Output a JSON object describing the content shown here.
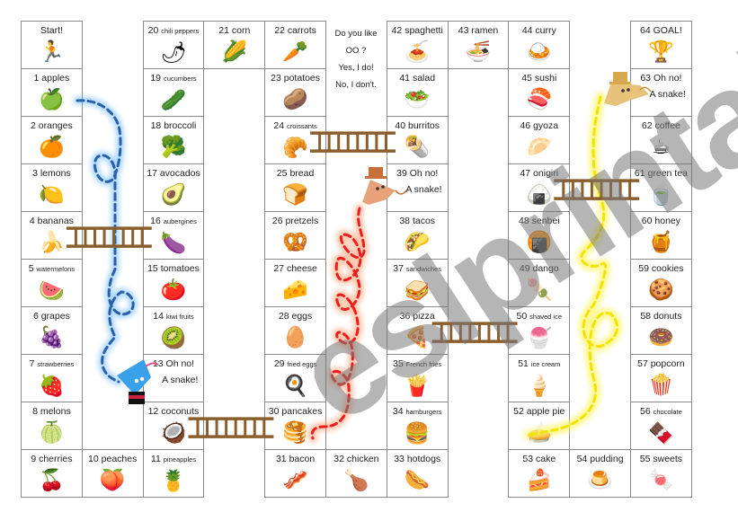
{
  "board": {
    "question": [
      "Do you like",
      "OO ?",
      "Yes, I do!",
      "No, I don't."
    ],
    "cells": [
      {
        "n": "",
        "label": "Start!",
        "small": false,
        "icon": "runner-icon",
        "glyph": "🏃",
        "col": 0,
        "row": 0
      },
      {
        "n": "1",
        "label": "apples",
        "small": false,
        "icon": "apple-icon",
        "glyph": "🍏",
        "col": 0,
        "row": 1
      },
      {
        "n": "2",
        "label": "oranges",
        "small": false,
        "icon": "orange-icon",
        "glyph": "🍊",
        "col": 0,
        "row": 2
      },
      {
        "n": "3",
        "label": "lemons",
        "small": false,
        "icon": "lemon-icon",
        "glyph": "🍋",
        "col": 0,
        "row": 3
      },
      {
        "n": "4",
        "label": "bananas",
        "small": false,
        "icon": "banana-icon",
        "glyph": "🍌",
        "col": 0,
        "row": 4
      },
      {
        "n": "5",
        "label": "watermelons",
        "small": true,
        "icon": "watermelon-icon",
        "glyph": "🍉",
        "col": 0,
        "row": 5
      },
      {
        "n": "6",
        "label": "grapes",
        "small": false,
        "icon": "grapes-icon",
        "glyph": "🍇",
        "col": 0,
        "row": 6
      },
      {
        "n": "7",
        "label": "strawberries",
        "small": true,
        "icon": "strawberry-icon",
        "glyph": "🍓",
        "col": 0,
        "row": 7
      },
      {
        "n": "8",
        "label": "melons",
        "small": false,
        "icon": "melon-icon",
        "glyph": "🍈",
        "col": 0,
        "row": 8
      },
      {
        "n": "9",
        "label": "cherries",
        "small": false,
        "icon": "cherries-icon",
        "glyph": "🍒",
        "col": 0,
        "row": 9
      },
      {
        "n": "10",
        "label": "peaches",
        "small": false,
        "icon": "peach-icon",
        "glyph": "🍑",
        "col": 1,
        "row": 9
      },
      {
        "n": "11",
        "label": "pineapples",
        "small": true,
        "icon": "pineapple-icon",
        "glyph": "🍍",
        "col": 2,
        "row": 9
      },
      {
        "n": "12",
        "label": "coconuts",
        "small": false,
        "icon": "coconut-icon",
        "glyph": "🥥",
        "col": 2,
        "row": 8
      },
      {
        "n": "13",
        "label": "Oh no!",
        "small": false,
        "icon": "",
        "glyph": "",
        "snake": "A snake!",
        "col": 2,
        "row": 7
      },
      {
        "n": "14",
        "label": "kiwi fruits",
        "small": true,
        "icon": "kiwi-icon",
        "glyph": "🥝",
        "col": 2,
        "row": 6
      },
      {
        "n": "15",
        "label": "tomatoes",
        "small": false,
        "icon": "tomato-icon",
        "glyph": "🍅",
        "col": 2,
        "row": 5
      },
      {
        "n": "16",
        "label": "aubergines",
        "small": true,
        "icon": "eggplant-icon",
        "glyph": "🍆",
        "col": 2,
        "row": 4
      },
      {
        "n": "17",
        "label": "avocados",
        "small": false,
        "icon": "avocado-icon",
        "glyph": "🥑",
        "col": 2,
        "row": 3
      },
      {
        "n": "18",
        "label": "broccoli",
        "small": false,
        "icon": "broccoli-icon",
        "glyph": "🥦",
        "col": 2,
        "row": 2
      },
      {
        "n": "19",
        "label": "cucumbers",
        "small": true,
        "icon": "cucumber-icon",
        "glyph": "🥒",
        "col": 2,
        "row": 1
      },
      {
        "n": "20",
        "label": "chili peppers",
        "small": true,
        "icon": "chili-pepper-icon",
        "glyph": "🌶",
        "col": 2,
        "row": 0
      },
      {
        "n": "21",
        "label": "corn",
        "small": false,
        "icon": "corn-icon",
        "glyph": "🌽",
        "col": 3,
        "row": 0
      },
      {
        "n": "22",
        "label": "carrots",
        "small": false,
        "icon": "carrot-icon",
        "glyph": "🥕",
        "col": 4,
        "row": 0
      },
      {
        "n": "23",
        "label": "potatoes",
        "small": false,
        "icon": "potato-icon",
        "glyph": "🥔",
        "col": 4,
        "row": 1
      },
      {
        "n": "24",
        "label": "croissants",
        "small": true,
        "icon": "croissant-icon",
        "glyph": "🥐",
        "col": 4,
        "row": 2
      },
      {
        "n": "25",
        "label": "bread",
        "small": false,
        "icon": "bread-icon",
        "glyph": "🍞",
        "col": 4,
        "row": 3
      },
      {
        "n": "26",
        "label": "pretzels",
        "small": false,
        "icon": "pretzel-icon",
        "glyph": "🥨",
        "col": 4,
        "row": 4
      },
      {
        "n": "27",
        "label": "cheese",
        "small": false,
        "icon": "cheese-icon",
        "glyph": "🧀",
        "col": 4,
        "row": 5
      },
      {
        "n": "28",
        "label": "eggs",
        "small": false,
        "icon": "egg-icon",
        "glyph": "🥚",
        "col": 4,
        "row": 6
      },
      {
        "n": "29",
        "label": "fried eggs",
        "small": true,
        "icon": "fried-egg-icon",
        "glyph": "🍳",
        "col": 4,
        "row": 7
      },
      {
        "n": "30",
        "label": "pancakes",
        "small": false,
        "icon": "pancakes-icon",
        "glyph": "🥞",
        "col": 4,
        "row": 8
      },
      {
        "n": "31",
        "label": "bacon",
        "small": false,
        "icon": "bacon-icon",
        "glyph": "🥓",
        "col": 4,
        "row": 9
      },
      {
        "n": "32",
        "label": "chicken",
        "small": false,
        "icon": "chicken-leg-icon",
        "glyph": "🍗",
        "col": 5,
        "row": 9
      },
      {
        "n": "33",
        "label": "hotdogs",
        "small": false,
        "icon": "hotdog-icon",
        "glyph": "🌭",
        "col": 6,
        "row": 9
      },
      {
        "n": "34",
        "label": "hamburgers",
        "small": true,
        "icon": "hamburger-icon",
        "glyph": "🍔",
        "col": 6,
        "row": 8
      },
      {
        "n": "35",
        "label": "French fries",
        "small": true,
        "icon": "french-fries-icon",
        "glyph": "🍟",
        "col": 6,
        "row": 7
      },
      {
        "n": "36",
        "label": "pizza",
        "small": false,
        "icon": "pizza-icon",
        "glyph": "🍕",
        "col": 6,
        "row": 6
      },
      {
        "n": "37",
        "label": "sandwiches",
        "small": true,
        "icon": "sandwich-icon",
        "glyph": "🥪",
        "col": 6,
        "row": 5
      },
      {
        "n": "38",
        "label": "tacos",
        "small": false,
        "icon": "taco-icon",
        "glyph": "🌮",
        "col": 6,
        "row": 4
      },
      {
        "n": "39",
        "label": "Oh no!",
        "small": false,
        "icon": "",
        "glyph": "",
        "snake": "A snake!",
        "col": 6,
        "row": 3
      },
      {
        "n": "40",
        "label": "burritos",
        "small": false,
        "icon": "burrito-icon",
        "glyph": "🌯",
        "col": 6,
        "row": 2
      },
      {
        "n": "41",
        "label": "salad",
        "small": false,
        "icon": "salad-icon",
        "glyph": "🥗",
        "col": 6,
        "row": 1
      },
      {
        "n": "42",
        "label": "spaghetti",
        "small": false,
        "icon": "spaghetti-icon",
        "glyph": "🍝",
        "col": 6,
        "row": 0
      },
      {
        "n": "43",
        "label": "ramen",
        "small": false,
        "icon": "ramen-icon",
        "glyph": "🍜",
        "col": 7,
        "row": 0
      },
      {
        "n": "44",
        "label": "curry",
        "small": false,
        "icon": "curry-icon",
        "glyph": "🍛",
        "col": 8,
        "row": 0
      },
      {
        "n": "45",
        "label": "sushi",
        "small": false,
        "icon": "sushi-icon",
        "glyph": "🍣",
        "col": 8,
        "row": 1
      },
      {
        "n": "46",
        "label": "gyoza",
        "small": false,
        "icon": "dumpling-icon",
        "glyph": "🥟",
        "col": 8,
        "row": 2
      },
      {
        "n": "47",
        "label": "onigiri",
        "small": false,
        "icon": "rice-ball-icon",
        "glyph": "🍙",
        "col": 8,
        "row": 3
      },
      {
        "n": "48",
        "label": "senbei",
        "small": false,
        "icon": "rice-cracker-icon",
        "glyph": "🍘",
        "col": 8,
        "row": 4
      },
      {
        "n": "49",
        "label": "dango",
        "small": false,
        "icon": "dango-icon",
        "glyph": "🍡",
        "col": 8,
        "row": 5
      },
      {
        "n": "50",
        "label": "shaved ice",
        "small": true,
        "icon": "shaved-ice-icon",
        "glyph": "🍧",
        "col": 8,
        "row": 6
      },
      {
        "n": "51",
        "label": "ice cream",
        "small": true,
        "icon": "ice-cream-icon",
        "glyph": "🍦",
        "col": 8,
        "row": 7
      },
      {
        "n": "52",
        "label": "apple pie",
        "small": false,
        "icon": "pie-icon",
        "glyph": "🥧",
        "col": 8,
        "row": 8
      },
      {
        "n": "53",
        "label": "cake",
        "small": false,
        "icon": "cake-icon",
        "glyph": "🍰",
        "col": 8,
        "row": 9
      },
      {
        "n": "54",
        "label": "pudding",
        "small": false,
        "icon": "pudding-icon",
        "glyph": "🍮",
        "col": 9,
        "row": 9
      },
      {
        "n": "55",
        "label": "sweets",
        "small": false,
        "icon": "candy-icon",
        "glyph": "🍬",
        "col": 10,
        "row": 9
      },
      {
        "n": "56",
        "label": "chocolate",
        "small": true,
        "icon": "chocolate-icon",
        "glyph": "🍫",
        "col": 10,
        "row": 8
      },
      {
        "n": "57",
        "label": "popcorn",
        "small": false,
        "icon": "popcorn-icon",
        "glyph": "🍿",
        "col": 10,
        "row": 7
      },
      {
        "n": "58",
        "label": "donuts",
        "small": false,
        "icon": "donut-icon",
        "glyph": "🍩",
        "col": 10,
        "row": 6
      },
      {
        "n": "59",
        "label": "cookies",
        "small": false,
        "icon": "cookie-icon",
        "glyph": "🍪",
        "col": 10,
        "row": 5
      },
      {
        "n": "60",
        "label": "honey",
        "small": false,
        "icon": "honey-pot-icon",
        "glyph": "🍯",
        "col": 10,
        "row": 4
      },
      {
        "n": "61",
        "label": "green tea",
        "small": false,
        "icon": "green-tea-icon",
        "glyph": "🍵",
        "col": 10,
        "row": 3
      },
      {
        "n": "62",
        "label": "coffee",
        "small": false,
        "icon": "coffee-icon",
        "glyph": "☕",
        "col": 10,
        "row": 2
      },
      {
        "n": "63",
        "label": "Oh no!",
        "small": false,
        "icon": "",
        "glyph": "",
        "snake": "A snake!",
        "col": 10,
        "row": 1
      },
      {
        "n": "64",
        "label": "GOAL!",
        "small": false,
        "icon": "trophy-icon",
        "glyph": "🏆",
        "col": 10,
        "row": 0
      }
    ],
    "ladders": [
      {
        "from": "4",
        "to": "16"
      },
      {
        "from": "12",
        "to": "30"
      },
      {
        "from": "24",
        "to": "40"
      },
      {
        "from": "36",
        "to": "50"
      },
      {
        "from": "47",
        "to": "61"
      }
    ],
    "snakes": [
      {
        "head": "13",
        "tail": "1",
        "color": "#2b5fa8",
        "glow": "#6ab8ff"
      },
      {
        "head": "39",
        "tail": "30",
        "color": "#ee1c1c",
        "glow": "#ff9a6a"
      },
      {
        "head": "63",
        "tail": "52",
        "color": "#f2e400",
        "glow": "#fff56a"
      }
    ],
    "ladder_color": "#8b5e2e"
  },
  "watermark": "eslprintables.com"
}
